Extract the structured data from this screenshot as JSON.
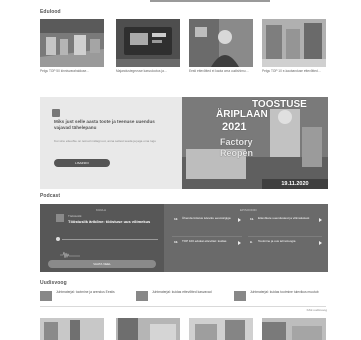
{
  "sections": {
    "stories_title": "Edulood",
    "podcast_title": "Podcast",
    "news_title": "Uudisvoog"
  },
  "stories": [
    {
      "caption": "Pelgu TOP 50 kinnisvarahalduse…"
    },
    {
      "caption": "Majandustegevuse kasvulootus ja…"
    },
    {
      "caption": "Eesti ettevõtted ei kaota oma uudishimu…"
    },
    {
      "caption": "Pelgu TOP 10 e-kaubanduse ettevõtted…"
    }
  ],
  "banner": {
    "headline": "Miks just selle aasta toote ja teenuse uuendus vajavad tähelepanu",
    "subtext": "Kui sinu ettevõte on teinud midagi uut, anna sellest teada ja jaga oma lugu",
    "button": "LISAINFO",
    "title_line1": "TOOSTUSE",
    "title_line2": "ÄRIPLAAN",
    "year": "2021",
    "word1": "Factory",
    "word2": "Reopen",
    "date": "19.11.2020"
  },
  "podcast": {
    "left_header": "KUULA",
    "right_header": "EPISOODID",
    "show_name": "Tööstuslik",
    "episode_title": "Tööstuslik ärikõne: tööstuse uus võimekus",
    "listen_button": "VAATA VEEL",
    "episodes": [
      {
        "num": "12.",
        "title": "Ühenda tööstus tuleviku eesmärgiga"
      },
      {
        "num": "11.",
        "title": "Ettevõtete uuendustest ja võimalustest"
      },
      {
        "num": "10.",
        "title": "TOP 100 edukat ettevõtet: kuidas"
      },
      {
        "num": "9.",
        "title": "Tootmine ja uus tehnoloogia"
      }
    ]
  },
  "news": [
    {
      "text": "Juhtmaterjal: tootmine ja arendus Eestis"
    },
    {
      "text": "Juhtmaterjal: kuidas ettevõtted kasvavad"
    },
    {
      "text": "Juhtmaterjal: kuidas tootmine tulevikus muutub"
    }
  ],
  "news_more": "Kõik uudisvoog"
}
